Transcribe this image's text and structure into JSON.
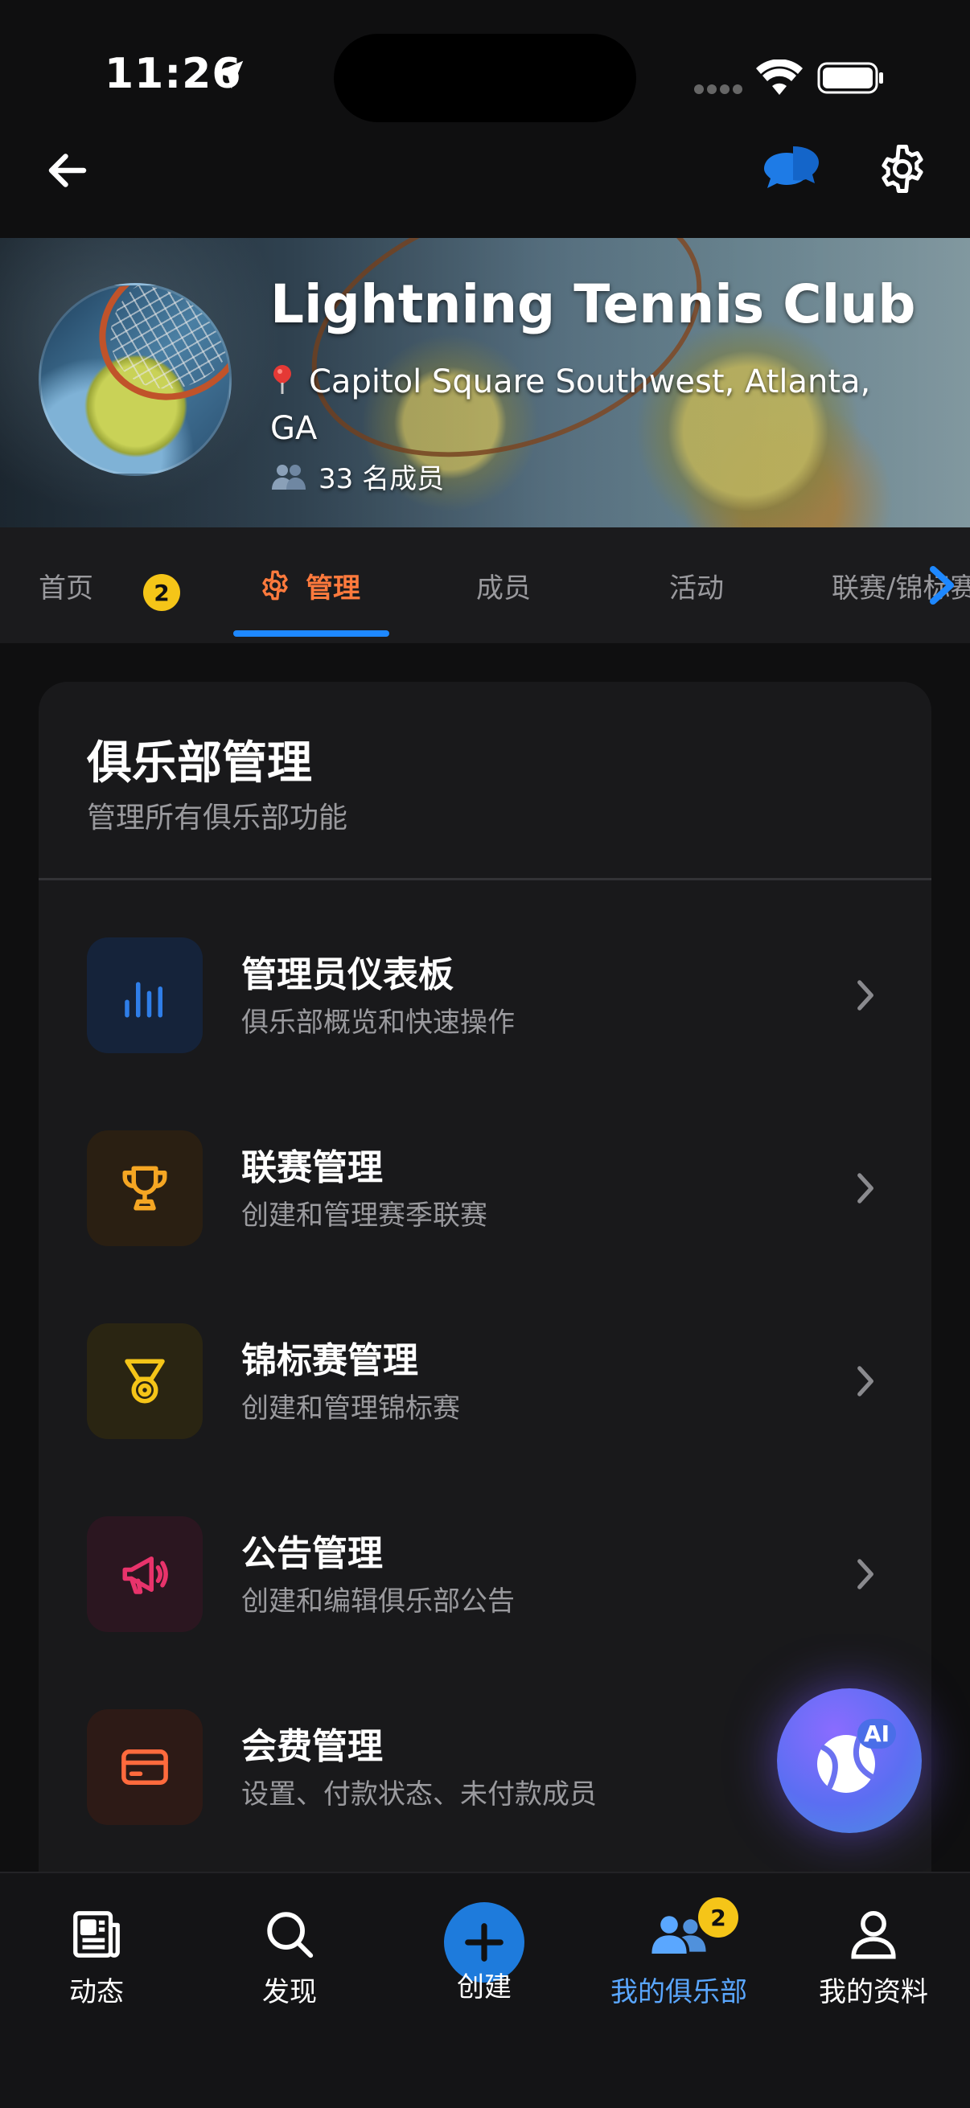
{
  "status_bar": {
    "time": "11:26"
  },
  "club": {
    "name": "Lightning Tennis Club",
    "location": "Capitol Square Southwest, Atlanta, GA",
    "members_label": "33 名成员"
  },
  "tabs": [
    {
      "label": "首页",
      "badge": "2"
    },
    {
      "label": "管理"
    },
    {
      "label": "成员"
    },
    {
      "label": "活动"
    },
    {
      "label": "联赛/锦标赛"
    }
  ],
  "card": {
    "title": "俱乐部管理",
    "subtitle": "管理所有俱乐部功能",
    "items": [
      {
        "title": "管理员仪表板",
        "subtitle": "俱乐部概览和快速操作",
        "icon": "bar-chart-icon",
        "color": "#2f7ee8"
      },
      {
        "title": "联赛管理",
        "subtitle": "创建和管理赛季联赛",
        "icon": "trophy-icon",
        "color": "#f5a623"
      },
      {
        "title": "锦标赛管理",
        "subtitle": "创建和管理锦标赛",
        "icon": "medal-icon",
        "color": "#f5c518"
      },
      {
        "title": "公告管理",
        "subtitle": "创建和编辑俱乐部公告",
        "icon": "megaphone-icon",
        "color": "#e8336b"
      },
      {
        "title": "会费管理",
        "subtitle": "设置、付款状态、未付款成员",
        "icon": "credit-card-icon",
        "color": "#ff6a3d"
      }
    ]
  },
  "ai_fab": {
    "label": "AI"
  },
  "bottom_nav": [
    {
      "label": "动态",
      "icon": "newspaper-icon"
    },
    {
      "label": "发现",
      "icon": "search-icon"
    },
    {
      "label": "创建",
      "icon": "plus-icon"
    },
    {
      "label": "我的俱乐部",
      "icon": "people-icon",
      "badge": "2",
      "active": true
    },
    {
      "label": "我的资料",
      "icon": "person-icon"
    }
  ],
  "colors": {
    "accent_blue": "#1e88ff",
    "accent_orange": "#ff7a3d",
    "badge_yellow": "#f5c518"
  }
}
